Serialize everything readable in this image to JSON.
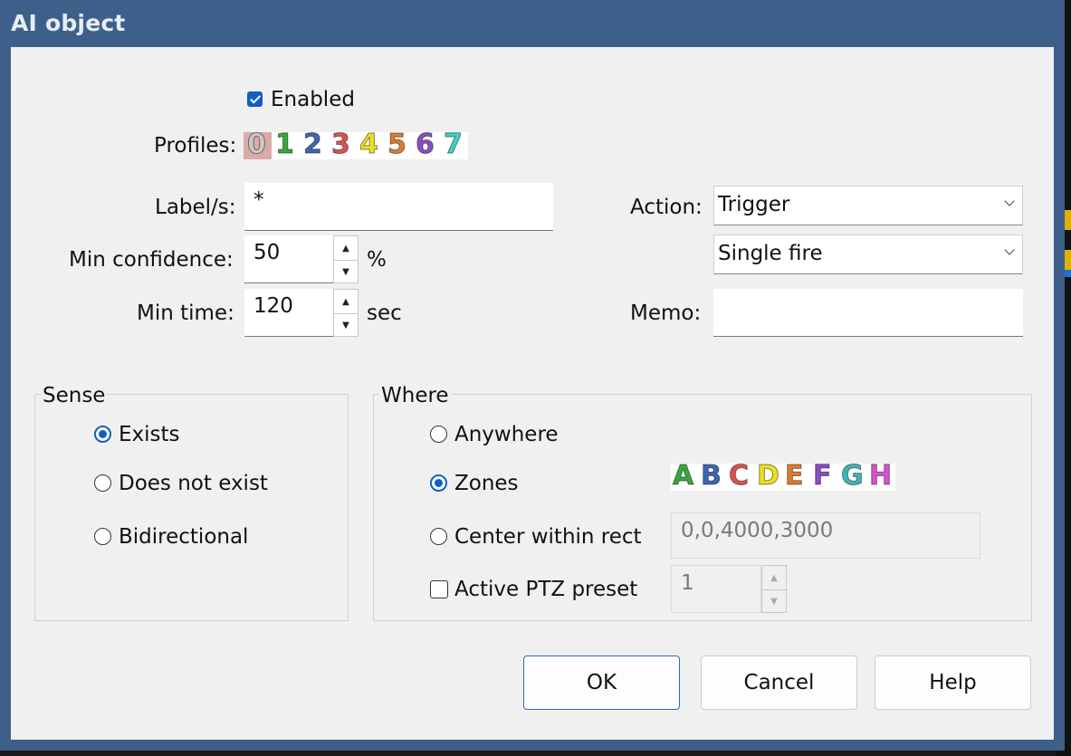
{
  "window": {
    "title": "AI object"
  },
  "enabled": {
    "label": "Enabled",
    "checked": true
  },
  "profiles": {
    "label": "Profiles:",
    "items": [
      {
        "text": "0",
        "color": "#c9c9c9"
      },
      {
        "text": "1",
        "color": "#39a83a"
      },
      {
        "text": "2",
        "color": "#3b67b4"
      },
      {
        "text": "3",
        "color": "#d9534f"
      },
      {
        "text": "4",
        "color": "#ece11f"
      },
      {
        "text": "5",
        "color": "#e07b2c"
      },
      {
        "text": "6",
        "color": "#8a4ec4"
      },
      {
        "text": "7",
        "color": "#3dd1c1"
      }
    ],
    "selected": "0"
  },
  "labels_field": {
    "label": "Label/s:",
    "value": "*"
  },
  "min_confidence": {
    "label": "Min confidence:",
    "value": "50",
    "unit": "%"
  },
  "min_time": {
    "label": "Min time:",
    "value": "120",
    "unit": "sec"
  },
  "action": {
    "label": "Action:",
    "value": "Trigger",
    "mode": "Single fire"
  },
  "memo": {
    "label": "Memo:",
    "value": ""
  },
  "sense": {
    "title": "Sense",
    "options": [
      {
        "label": "Exists",
        "checked": true
      },
      {
        "label": "Does not exist",
        "checked": false
      },
      {
        "label": "Bidirectional",
        "checked": false
      }
    ]
  },
  "where": {
    "title": "Where",
    "anywhere": {
      "label": "Anywhere",
      "checked": false
    },
    "zones": {
      "label": "Zones",
      "checked": true
    },
    "zone_letters": [
      {
        "text": "A",
        "color": "#39a83a"
      },
      {
        "text": "B",
        "color": "#3b67b4"
      },
      {
        "text": "C",
        "color": "#d9534f"
      },
      {
        "text": "D",
        "color": "#ece11f"
      },
      {
        "text": "E",
        "color": "#e07b2c"
      },
      {
        "text": "F",
        "color": "#8a4ec4"
      },
      {
        "text": "G",
        "color": "#3db5b5"
      },
      {
        "text": "H",
        "color": "#d94fd1"
      }
    ],
    "center_rect": {
      "label": "Center within rect",
      "checked": false,
      "value": "0,0,4000,3000"
    },
    "ptz": {
      "label": "Active PTZ preset",
      "checked": false,
      "value": "1"
    }
  },
  "buttons": {
    "ok": "OK",
    "cancel": "Cancel",
    "help": "Help"
  },
  "colors": {
    "titlebar": "#3e5f8a",
    "accent": "#1060c0"
  }
}
